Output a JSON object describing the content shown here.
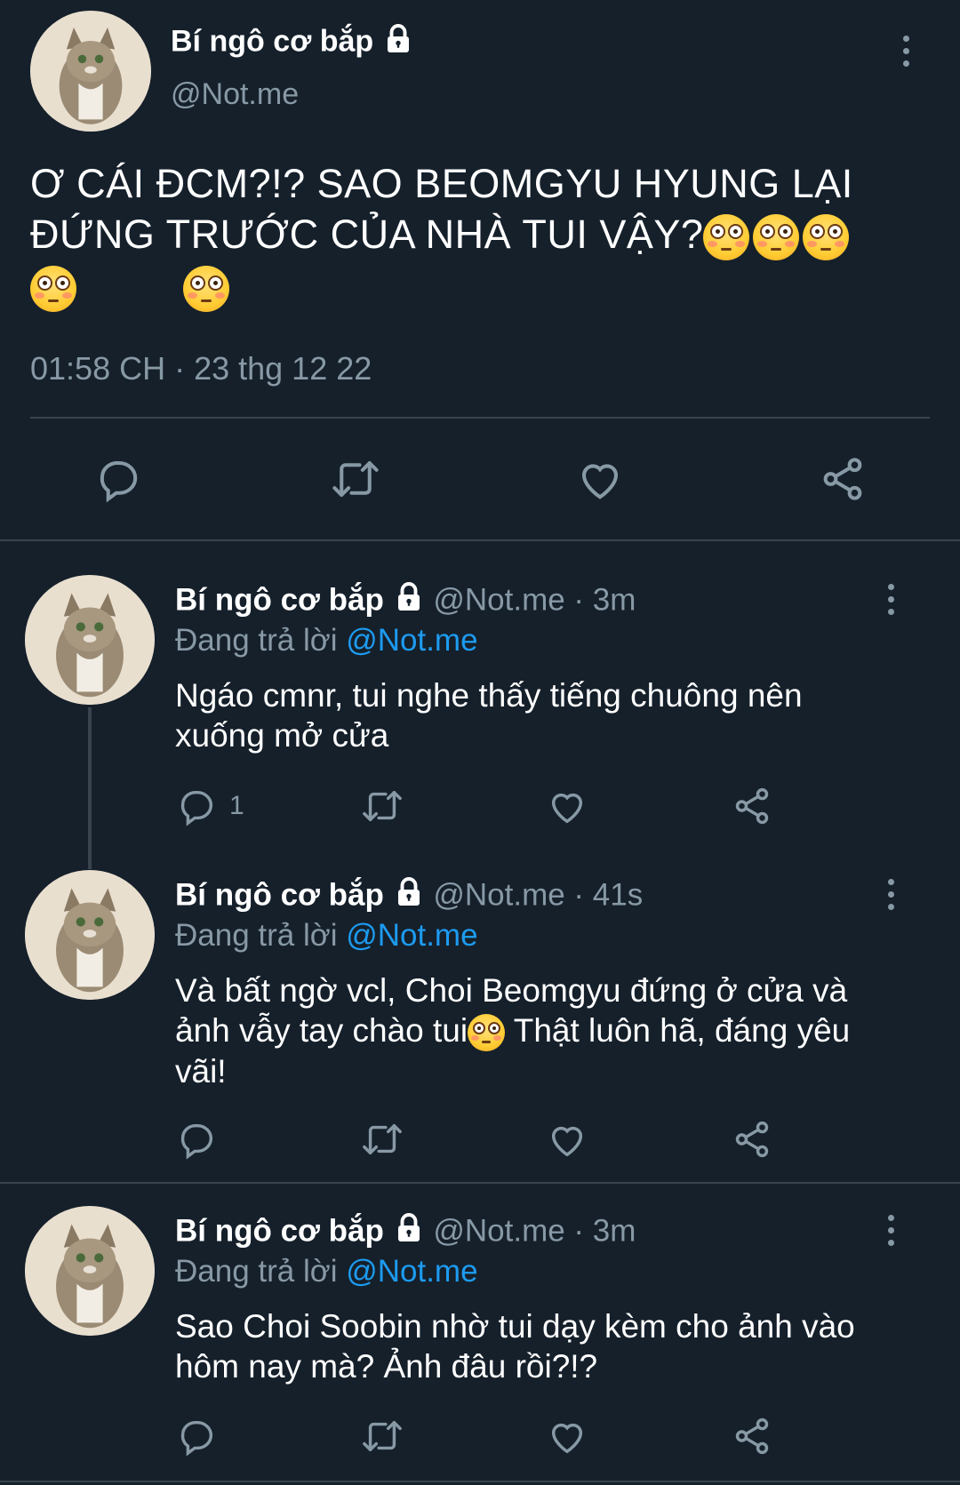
{
  "main_tweet": {
    "author_name": "Bí ngô cơ bắp",
    "handle": "@Not.me",
    "text": "Ơ CÁI ĐCM?!? SAO BEOMGYU HYUNG LẠI ĐỨNG TRƯỚC CỦA NHÀ TUI VẬY?",
    "emoji_count": 5,
    "timestamp": "01:58 CH · 23 thg 12 22",
    "actions": [
      "reply-icon",
      "retweet-icon",
      "like-icon",
      "share-icon"
    ]
  },
  "replies": [
    {
      "author_name": "Bí ngô cơ bắp",
      "handle_time": "@Not.me · 3m",
      "replying_prefix": "Đang trả lời",
      "replying_to": "@Not.me",
      "text_line1": "Ngáo cmnr, tui nghe thấy tiếng chuông nên",
      "text_line2": "xuống mở cửa",
      "reply_count": "1"
    },
    {
      "author_name": "Bí ngô cơ bắp",
      "handle_time": "@Not.me · 41s",
      "replying_prefix": "Đang trả lời",
      "replying_to": "@Not.me",
      "text_line1": "Và bất ngờ vcl, Choi Beomgyu đứng ở cửa và",
      "text_line2a": "ảnh vẫy tay chào tui",
      "text_line2b": " Thật luôn hã, đáng yêu",
      "text_line3": "vãi!"
    },
    {
      "author_name": "Bí ngô cơ bắp",
      "handle_time": "@Not.me · 3m",
      "replying_prefix": "Đang trả lời",
      "replying_to": "@Not.me",
      "text_line1": "Sao Choi Soobin nhờ tui dạy kèm cho ảnh vào",
      "text_line2": "hôm nay mà? Ảnh đâu rồi?!?"
    }
  ],
  "colors": {
    "background": "#15202b",
    "muted": "#8899a6",
    "link": "#1d9bf0",
    "divider": "#38444d"
  }
}
